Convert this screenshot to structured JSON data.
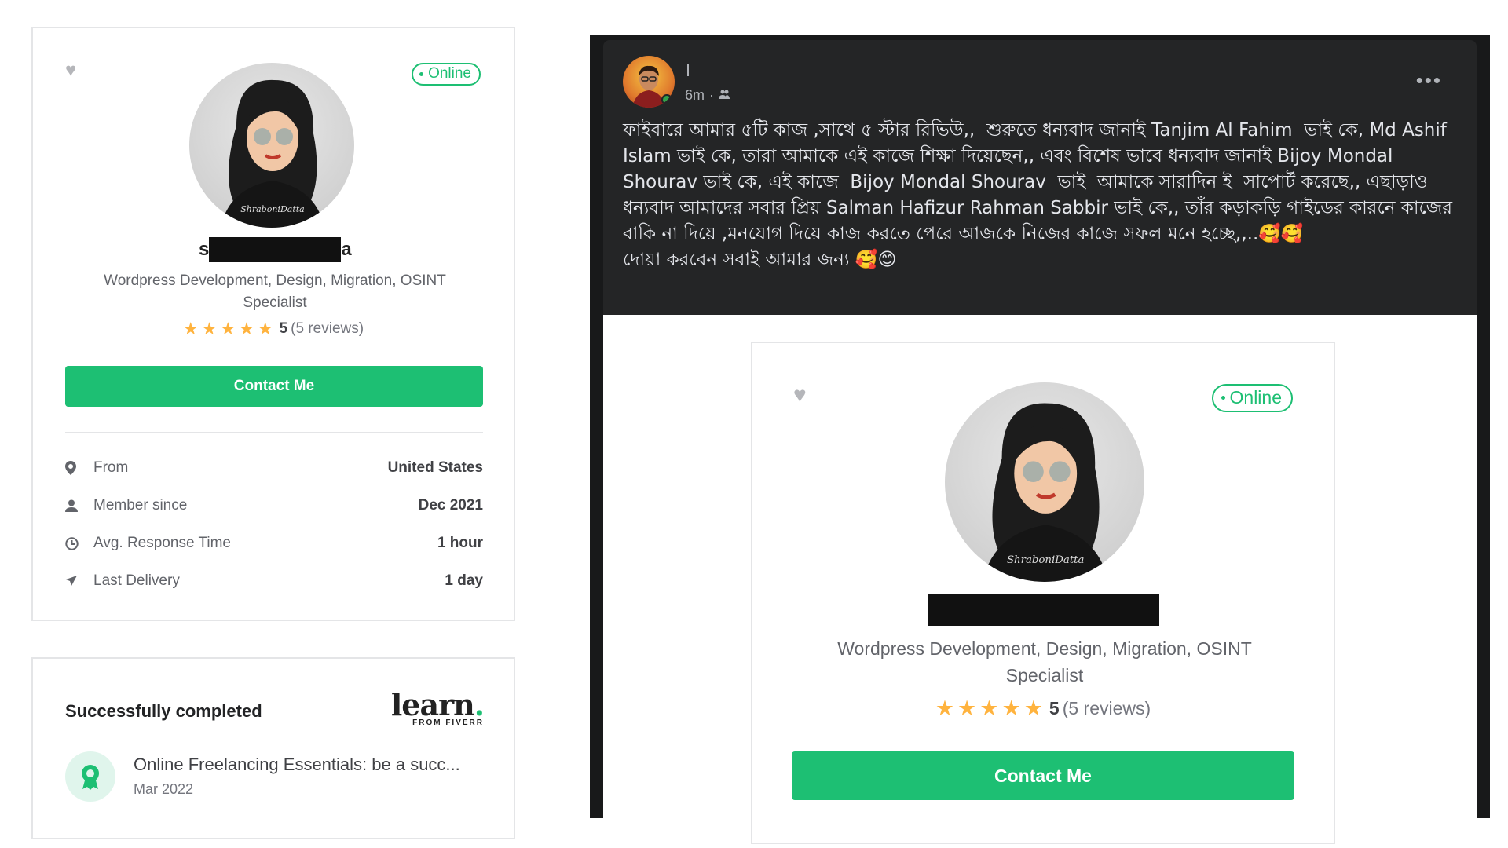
{
  "profile": {
    "name_first": "s",
    "name_last": "a",
    "status": "Online",
    "specialty": "Wordpress Development, Design, Migration, OSINT Specialist",
    "rating": "5",
    "reviews": "(5 reviews)",
    "contact_label": "Contact Me",
    "stats": [
      {
        "icon": "location-pin-icon",
        "label": "From",
        "value": "United States"
      },
      {
        "icon": "user-icon",
        "label": "Member since",
        "value": "Dec 2021"
      },
      {
        "icon": "clock-icon",
        "label": "Avg. Response Time",
        "value": "1 hour"
      },
      {
        "icon": "paper-plane-icon",
        "label": "Last Delivery",
        "value": "1 day"
      }
    ]
  },
  "learn": {
    "title": "Successfully completed",
    "logo_word": "learn",
    "logo_dot": ".",
    "logo_sub": "FROM FIVERR",
    "course_title": "Online Freelancing Essentials: be a succ...",
    "course_date": "Mar 2022"
  },
  "post": {
    "time": "6m",
    "separator": "·",
    "privacy_icon": "friends-icon",
    "more_label": "•••",
    "text": "ফাইবারে আমার ৫টি কাজ ,সাথে ৫ স্টার রিভিউ,,  শুরুতে ধন্যবাদ জানাই Tanjim Al Fahim  ভাই কে, Md Ashif Islam ভাই কে, তারা আমাকে এই কাজে শিক্ষা দিয়েছেন,, এবং বিশেষ ভাবে ধন্যবাদ জানাই Bijoy Mondal Shourav ভাই কে, এই কাজে  Bijoy Mondal Shourav  ভাই  আমাকে সারাদিন ই  সাপোর্ট করেছে,, এছাড়াও ধন্যবাদ আমাদের সবার প্রিয় Salman Hafizur Rahman Sabbir ভাই কে,, তাঁর কড়াকড়ি গাইডের কারনে কাজের বাকি না দিয়ে ,মনযোগ দিয়ে কাজ করতে পেরে আজকে নিজের কাজে সফল মনে হচ্ছে,,..🥰🥰\nদোয়া করবেন সবাই আমার জন্য 🥰😊"
  },
  "colors": {
    "accent": "#1dbf73",
    "star": "#ffb33e",
    "post_bg": "#242526"
  }
}
